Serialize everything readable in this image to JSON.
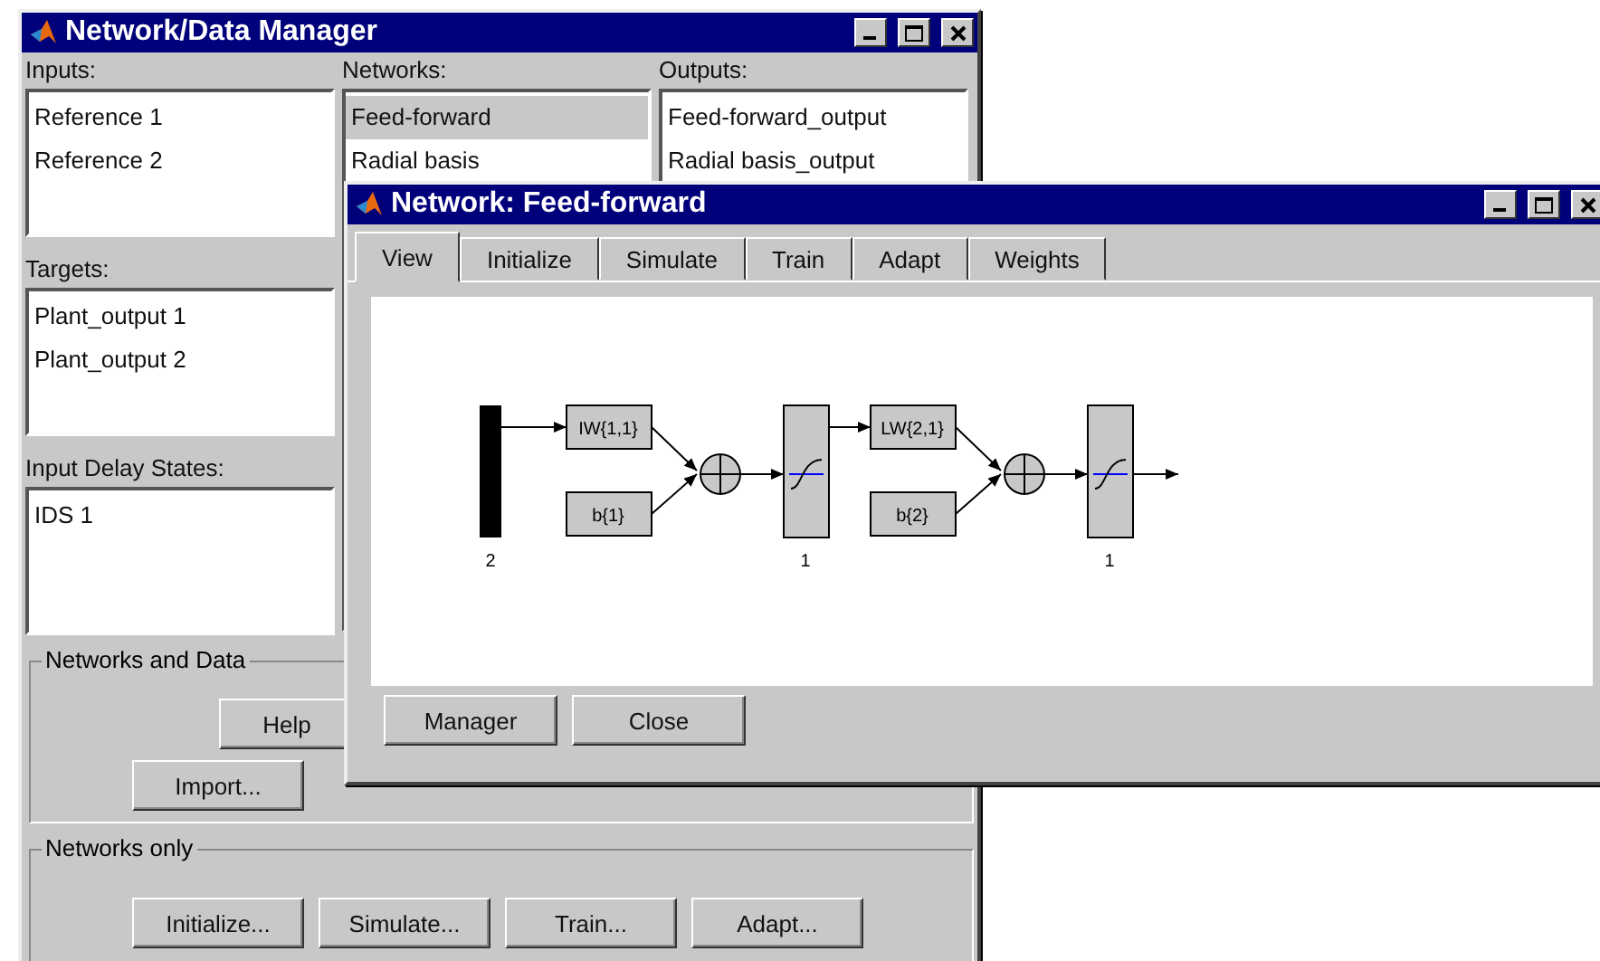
{
  "manager_window": {
    "title": "Network/Data Manager",
    "columns": [
      {
        "label": "Inputs:",
        "items": [
          {
            "text": "Reference 1",
            "selected": false
          },
          {
            "text": "Reference 2",
            "selected": false
          }
        ]
      },
      {
        "label": "Networks:",
        "items": [
          {
            "text": "Feed-forward",
            "selected": true
          },
          {
            "text": "Radial basis",
            "selected": false
          }
        ]
      },
      {
        "label": "Outputs:",
        "items": [
          {
            "text": "Feed-forward_output",
            "selected": false
          },
          {
            "text": "Radial basis_output",
            "selected": false
          }
        ]
      }
    ],
    "targets": {
      "label": "Targets:",
      "items": [
        {
          "text": "Plant_output 1",
          "selected": false
        },
        {
          "text": "Plant_output 2",
          "selected": false
        }
      ]
    },
    "input_delay_states": {
      "label": "Input Delay States:",
      "items": [
        {
          "text": "IDS 1",
          "selected": false
        }
      ]
    },
    "networks_and_data": {
      "label": "Networks and Data",
      "help_button": "Help",
      "buttons": [
        "Import..."
      ]
    },
    "networks_only": {
      "label": "Networks only",
      "buttons": [
        "Initialize...",
        "Simulate...",
        "Train...",
        "Adapt..."
      ]
    }
  },
  "network_window": {
    "title": "Network: Feed-forward",
    "tabs": [
      {
        "label": "View",
        "selected": true
      },
      {
        "label": "Initialize",
        "selected": false
      },
      {
        "label": "Simulate",
        "selected": false
      },
      {
        "label": "Train",
        "selected": false
      },
      {
        "label": "Adapt",
        "selected": false
      },
      {
        "label": "Weights",
        "selected": false
      }
    ],
    "diagram": {
      "input_size": "2",
      "layers": [
        {
          "weight": "IW{1,1}",
          "bias": "b{1}",
          "size": "1"
        },
        {
          "weight": "LW{2,1}",
          "bias": "b{2}",
          "size": "1"
        }
      ]
    },
    "buttons": [
      "Manager",
      "Close"
    ]
  }
}
